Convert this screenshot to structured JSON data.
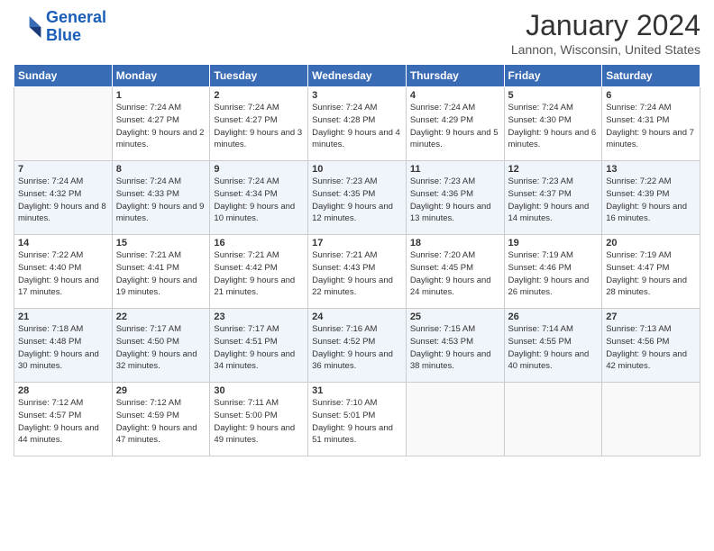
{
  "header": {
    "logo_line1": "General",
    "logo_line2": "Blue",
    "month": "January 2024",
    "location": "Lannon, Wisconsin, United States"
  },
  "weekdays": [
    "Sunday",
    "Monday",
    "Tuesday",
    "Wednesday",
    "Thursday",
    "Friday",
    "Saturday"
  ],
  "weeks": [
    [
      {
        "day": "",
        "sunrise": "",
        "sunset": "",
        "daylight": ""
      },
      {
        "day": "1",
        "sunrise": "Sunrise: 7:24 AM",
        "sunset": "Sunset: 4:27 PM",
        "daylight": "Daylight: 9 hours and 2 minutes."
      },
      {
        "day": "2",
        "sunrise": "Sunrise: 7:24 AM",
        "sunset": "Sunset: 4:27 PM",
        "daylight": "Daylight: 9 hours and 3 minutes."
      },
      {
        "day": "3",
        "sunrise": "Sunrise: 7:24 AM",
        "sunset": "Sunset: 4:28 PM",
        "daylight": "Daylight: 9 hours and 4 minutes."
      },
      {
        "day": "4",
        "sunrise": "Sunrise: 7:24 AM",
        "sunset": "Sunset: 4:29 PM",
        "daylight": "Daylight: 9 hours and 5 minutes."
      },
      {
        "day": "5",
        "sunrise": "Sunrise: 7:24 AM",
        "sunset": "Sunset: 4:30 PM",
        "daylight": "Daylight: 9 hours and 6 minutes."
      },
      {
        "day": "6",
        "sunrise": "Sunrise: 7:24 AM",
        "sunset": "Sunset: 4:31 PM",
        "daylight": "Daylight: 9 hours and 7 minutes."
      }
    ],
    [
      {
        "day": "7",
        "sunrise": "Sunrise: 7:24 AM",
        "sunset": "Sunset: 4:32 PM",
        "daylight": "Daylight: 9 hours and 8 minutes."
      },
      {
        "day": "8",
        "sunrise": "Sunrise: 7:24 AM",
        "sunset": "Sunset: 4:33 PM",
        "daylight": "Daylight: 9 hours and 9 minutes."
      },
      {
        "day": "9",
        "sunrise": "Sunrise: 7:24 AM",
        "sunset": "Sunset: 4:34 PM",
        "daylight": "Daylight: 9 hours and 10 minutes."
      },
      {
        "day": "10",
        "sunrise": "Sunrise: 7:23 AM",
        "sunset": "Sunset: 4:35 PM",
        "daylight": "Daylight: 9 hours and 12 minutes."
      },
      {
        "day": "11",
        "sunrise": "Sunrise: 7:23 AM",
        "sunset": "Sunset: 4:36 PM",
        "daylight": "Daylight: 9 hours and 13 minutes."
      },
      {
        "day": "12",
        "sunrise": "Sunrise: 7:23 AM",
        "sunset": "Sunset: 4:37 PM",
        "daylight": "Daylight: 9 hours and 14 minutes."
      },
      {
        "day": "13",
        "sunrise": "Sunrise: 7:22 AM",
        "sunset": "Sunset: 4:39 PM",
        "daylight": "Daylight: 9 hours and 16 minutes."
      }
    ],
    [
      {
        "day": "14",
        "sunrise": "Sunrise: 7:22 AM",
        "sunset": "Sunset: 4:40 PM",
        "daylight": "Daylight: 9 hours and 17 minutes."
      },
      {
        "day": "15",
        "sunrise": "Sunrise: 7:21 AM",
        "sunset": "Sunset: 4:41 PM",
        "daylight": "Daylight: 9 hours and 19 minutes."
      },
      {
        "day": "16",
        "sunrise": "Sunrise: 7:21 AM",
        "sunset": "Sunset: 4:42 PM",
        "daylight": "Daylight: 9 hours and 21 minutes."
      },
      {
        "day": "17",
        "sunrise": "Sunrise: 7:21 AM",
        "sunset": "Sunset: 4:43 PM",
        "daylight": "Daylight: 9 hours and 22 minutes."
      },
      {
        "day": "18",
        "sunrise": "Sunrise: 7:20 AM",
        "sunset": "Sunset: 4:45 PM",
        "daylight": "Daylight: 9 hours and 24 minutes."
      },
      {
        "day": "19",
        "sunrise": "Sunrise: 7:19 AM",
        "sunset": "Sunset: 4:46 PM",
        "daylight": "Daylight: 9 hours and 26 minutes."
      },
      {
        "day": "20",
        "sunrise": "Sunrise: 7:19 AM",
        "sunset": "Sunset: 4:47 PM",
        "daylight": "Daylight: 9 hours and 28 minutes."
      }
    ],
    [
      {
        "day": "21",
        "sunrise": "Sunrise: 7:18 AM",
        "sunset": "Sunset: 4:48 PM",
        "daylight": "Daylight: 9 hours and 30 minutes."
      },
      {
        "day": "22",
        "sunrise": "Sunrise: 7:17 AM",
        "sunset": "Sunset: 4:50 PM",
        "daylight": "Daylight: 9 hours and 32 minutes."
      },
      {
        "day": "23",
        "sunrise": "Sunrise: 7:17 AM",
        "sunset": "Sunset: 4:51 PM",
        "daylight": "Daylight: 9 hours and 34 minutes."
      },
      {
        "day": "24",
        "sunrise": "Sunrise: 7:16 AM",
        "sunset": "Sunset: 4:52 PM",
        "daylight": "Daylight: 9 hours and 36 minutes."
      },
      {
        "day": "25",
        "sunrise": "Sunrise: 7:15 AM",
        "sunset": "Sunset: 4:53 PM",
        "daylight": "Daylight: 9 hours and 38 minutes."
      },
      {
        "day": "26",
        "sunrise": "Sunrise: 7:14 AM",
        "sunset": "Sunset: 4:55 PM",
        "daylight": "Daylight: 9 hours and 40 minutes."
      },
      {
        "day": "27",
        "sunrise": "Sunrise: 7:13 AM",
        "sunset": "Sunset: 4:56 PM",
        "daylight": "Daylight: 9 hours and 42 minutes."
      }
    ],
    [
      {
        "day": "28",
        "sunrise": "Sunrise: 7:12 AM",
        "sunset": "Sunset: 4:57 PM",
        "daylight": "Daylight: 9 hours and 44 minutes."
      },
      {
        "day": "29",
        "sunrise": "Sunrise: 7:12 AM",
        "sunset": "Sunset: 4:59 PM",
        "daylight": "Daylight: 9 hours and 47 minutes."
      },
      {
        "day": "30",
        "sunrise": "Sunrise: 7:11 AM",
        "sunset": "Sunset: 5:00 PM",
        "daylight": "Daylight: 9 hours and 49 minutes."
      },
      {
        "day": "31",
        "sunrise": "Sunrise: 7:10 AM",
        "sunset": "Sunset: 5:01 PM",
        "daylight": "Daylight: 9 hours and 51 minutes."
      },
      {
        "day": "",
        "sunrise": "",
        "sunset": "",
        "daylight": ""
      },
      {
        "day": "",
        "sunrise": "",
        "sunset": "",
        "daylight": ""
      },
      {
        "day": "",
        "sunrise": "",
        "sunset": "",
        "daylight": ""
      }
    ]
  ]
}
